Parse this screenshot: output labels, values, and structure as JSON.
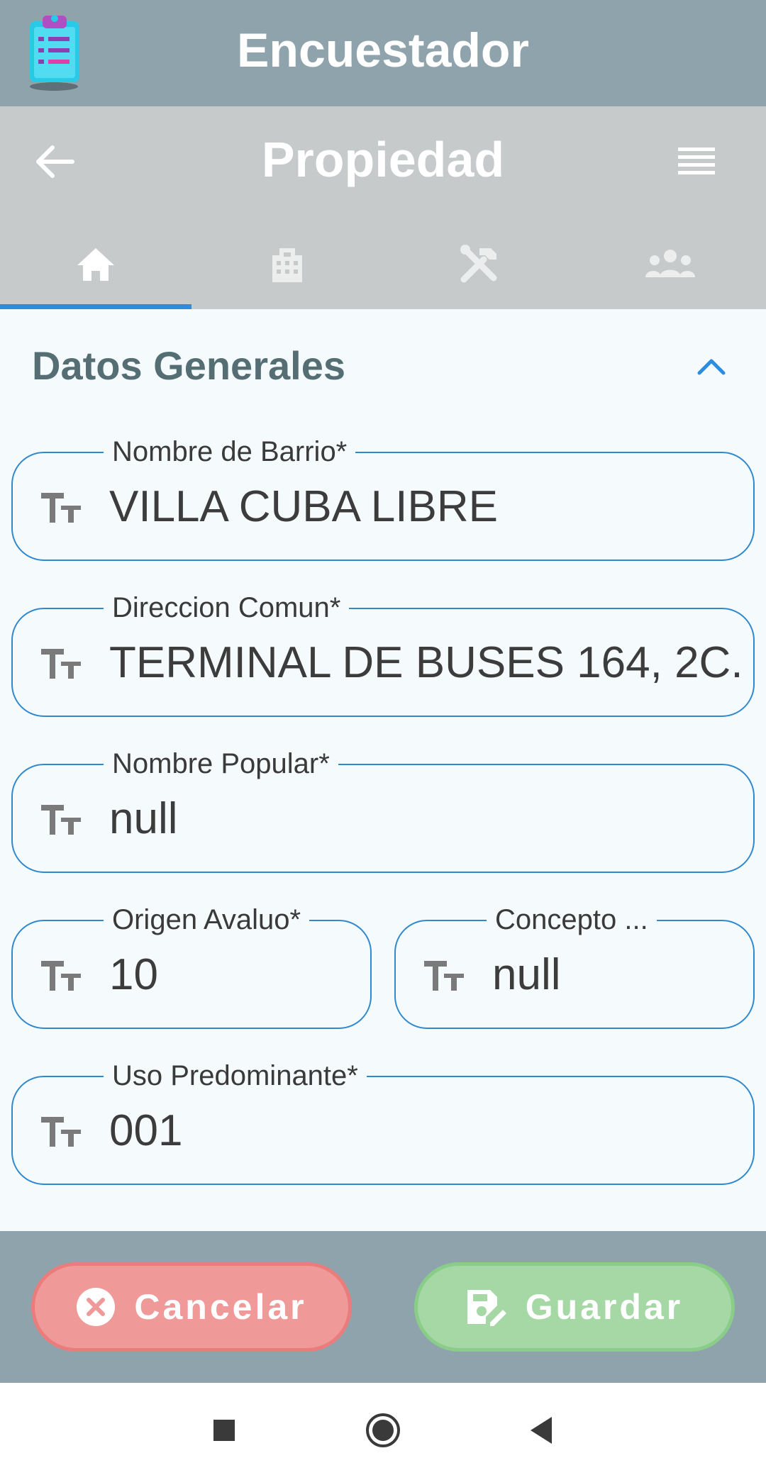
{
  "app": {
    "title": "Encuestador"
  },
  "header": {
    "title": "Propiedad"
  },
  "tabs": [
    {
      "icon": "home-icon",
      "active": true
    },
    {
      "icon": "building-icon",
      "active": false
    },
    {
      "icon": "tools-icon",
      "active": false
    },
    {
      "icon": "people-icon",
      "active": false
    }
  ],
  "section": {
    "title": "Datos Generales",
    "expanded": true
  },
  "fields": {
    "barrio": {
      "label": "Nombre de Barrio*",
      "value": "VILLA CUBA LIBRE"
    },
    "direccion": {
      "label": "Direccion Comun*",
      "value": "TERMINAL DE BUSES 164, 2C."
    },
    "popular": {
      "label": "Nombre Popular*",
      "value": "null"
    },
    "origen": {
      "label": "Origen Avaluo*",
      "value": "10"
    },
    "concepto": {
      "label": "Concepto ...",
      "value": "null"
    },
    "uso": {
      "label": "Uso Predominante*",
      "value": "001"
    }
  },
  "actions": {
    "cancel_label": "Cancelar",
    "save_label": "Guardar"
  },
  "colors": {
    "accent": "#2f89cf",
    "appbar": "#8fa3ad",
    "cancel": "#ef9999",
    "save": "#a6d8a6"
  }
}
